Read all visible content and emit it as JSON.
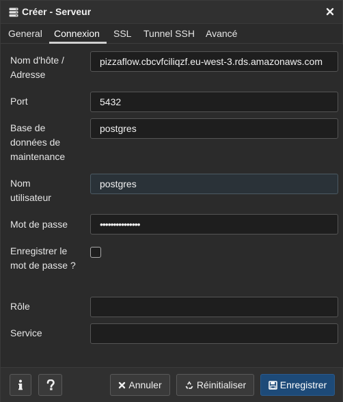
{
  "dialog": {
    "title": "Créer - Serveur",
    "icons": {
      "title": "server-icon",
      "close": "close-icon"
    }
  },
  "tabs": [
    {
      "label": "General",
      "active": false
    },
    {
      "label": "Connexion",
      "active": true
    },
    {
      "label": "SSL",
      "active": false
    },
    {
      "label": "Tunnel SSH",
      "active": false
    },
    {
      "label": "Avancé",
      "active": false
    }
  ],
  "form": {
    "host": {
      "label": "Nom d'hôte / Adresse",
      "value": "pizzaflow.cbcvfciliqzf.eu-west-3.rds.amazonaws.com"
    },
    "port": {
      "label": "Port",
      "value": "5432"
    },
    "maintenance_db": {
      "label": "Base de données de maintenance",
      "value": "postgres"
    },
    "username": {
      "label": "Nom utilisateur",
      "value": "postgres"
    },
    "password": {
      "label": "Mot de passe",
      "value": "•••••••••••••••"
    },
    "save_password": {
      "label": "Enregistrer le mot de passe ?",
      "checked": false
    },
    "role": {
      "label": "Rôle",
      "value": ""
    },
    "service": {
      "label": "Service",
      "value": ""
    }
  },
  "footer": {
    "info_icon": "info-icon",
    "help_icon": "help-icon",
    "cancel_label": "Annuler",
    "reset_label": "Réinitialiser",
    "save_label": "Enregistrer"
  },
  "colors": {
    "background": "#2b2b2b",
    "input_bg": "#1e1e1e",
    "primary_button": "#1d4a78"
  }
}
